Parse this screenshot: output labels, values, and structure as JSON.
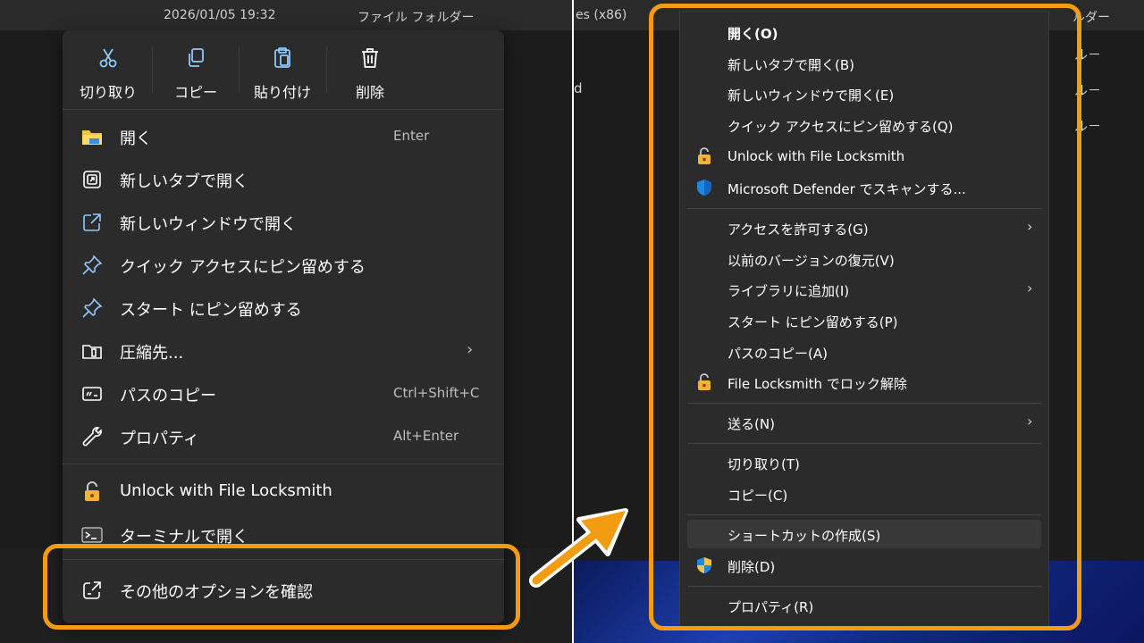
{
  "left": {
    "top_bar": {
      "date": "2026/01/05 19:32",
      "type": "ファイル フォルダー"
    },
    "quick_actions": [
      {
        "label": "切り取り",
        "icon": "scissors-icon"
      },
      {
        "label": "コピー",
        "icon": "copy-icon"
      },
      {
        "label": "貼り付け",
        "icon": "paste-icon"
      },
      {
        "label": "削除",
        "icon": "trash-icon"
      }
    ],
    "items": [
      {
        "label": "開く",
        "shortcut": "Enter",
        "icon": "folder-icon"
      },
      {
        "label": "新しいタブで開く",
        "icon": "new-tab-icon"
      },
      {
        "label": "新しいウィンドウで開く",
        "icon": "new-window-icon"
      },
      {
        "label": "クイック アクセスにピン留めする",
        "icon": "pin-icon"
      },
      {
        "label": "スタート にピン留めする",
        "icon": "pin-icon"
      },
      {
        "label": "圧縮先...",
        "icon": "compress-icon",
        "submenu": true
      },
      {
        "label": "パスのコピー",
        "shortcut": "Ctrl+Shift+C",
        "icon": "copy-path-icon"
      },
      {
        "label": "プロパティ",
        "shortcut": "Alt+Enter",
        "icon": "wrench-icon"
      },
      {
        "label": "Unlock with File Locksmith",
        "icon": "unlock-icon"
      },
      {
        "label": "ターミナルで開く",
        "icon": "terminal-icon"
      },
      {
        "label": "その他のオプションを確認",
        "icon": "more-options-icon"
      }
    ]
  },
  "right": {
    "top_bar": {
      "left_text": "es (x86)",
      "right_text": "ルダー"
    },
    "bg_rows": {
      "d": "d",
      "r": "ル－"
    },
    "items": [
      {
        "label": "開く(O)",
        "bold": true
      },
      {
        "label": "新しいタブで開く(B)"
      },
      {
        "label": "新しいウィンドウで開く(E)"
      },
      {
        "label": "クイック アクセスにピン留めする(Q)"
      },
      {
        "label": "Unlock with File Locksmith",
        "icon": "unlock-icon"
      },
      {
        "label": "Microsoft Defender でスキャンする...",
        "icon": "shield-icon"
      },
      {
        "label": "アクセスを許可する(G)",
        "submenu": true
      },
      {
        "label": "以前のバージョンの復元(V)"
      },
      {
        "label": "ライブラリに追加(I)",
        "submenu": true
      },
      {
        "label": "スタート にピン留めする(P)"
      },
      {
        "label": "パスのコピー(A)"
      },
      {
        "label": "File Locksmith でロック解除",
        "icon": "unlock-icon"
      },
      {
        "label": "送る(N)",
        "submenu": true
      },
      {
        "label": "切り取り(T)"
      },
      {
        "label": "コピー(C)"
      },
      {
        "label": "ショートカットの作成(S)",
        "highlighted": true
      },
      {
        "label": "削除(D)",
        "icon": "uac-shield-icon"
      },
      {
        "label": "プロパティ(R)"
      }
    ],
    "submenu_glyph": "›"
  },
  "colors": {
    "accent_frame": "#f39c12",
    "menu_bg": "#2b2b2b",
    "explorer_bg": "#1c1c1c"
  }
}
